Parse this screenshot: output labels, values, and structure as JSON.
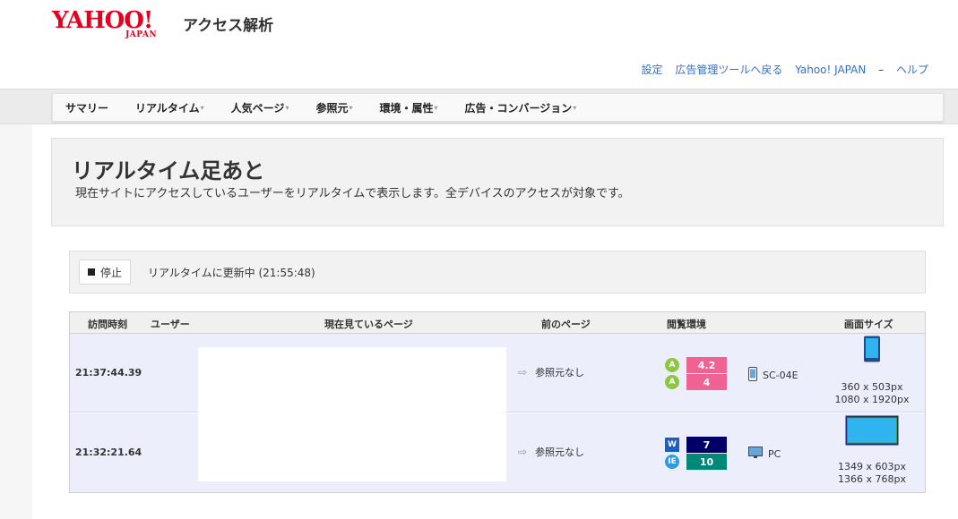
{
  "header": {
    "logo_main": "YAHOO!",
    "logo_sub": "JAPAN",
    "app_title": "アクセス解析",
    "links": [
      "設定",
      "広告管理ツールへ戻る",
      "Yahoo! JAPAN"
    ],
    "separator": "–",
    "help": "ヘルプ"
  },
  "nav": {
    "items": [
      "サマリー",
      "リアルタイム",
      "人気ページ",
      "参照元",
      "環境・属性",
      "広告・コンバージョン"
    ],
    "caret": "▾"
  },
  "page": {
    "title": "リアルタイム足あと",
    "description": "現在サイトにアクセスしているユーザーをリアルタイムで表示します。全デバイスのアクセスが対象です。"
  },
  "control": {
    "stop_label": "停止",
    "status": "リアルタイムに更新中 (21:55:48)"
  },
  "table": {
    "headers": [
      "訪問時刻",
      "ユーザー",
      "現在見ているページ",
      "前のページ",
      "閲覧環境",
      "画面サイズ"
    ],
    "rows": [
      {
        "time": "21:37:44.39",
        "referrer": "参照元なし",
        "os_badge": "A",
        "os_version": "4.2",
        "browser_badge": "A",
        "browser_version": "4",
        "os_color": "#f06292",
        "browser_color": "#f06292",
        "device": "SC-04E",
        "device_icon": "smartphone-icon",
        "screen_icon": "smartphone-screen-icon",
        "viewport": "360 x 503px",
        "screen": "1080 x 1920px"
      },
      {
        "time": "21:32:21.64",
        "referrer": "参照元なし",
        "os_badge": "W",
        "os_version": "7",
        "browser_badge": "IE",
        "browser_version": "10",
        "os_color": "#000066",
        "browser_color": "#008878",
        "device": "PC",
        "device_icon": "desktop-icon",
        "screen_icon": "desktop-screen-icon",
        "viewport": "1349 x 603px",
        "screen": "1366 x 768px"
      }
    ]
  }
}
